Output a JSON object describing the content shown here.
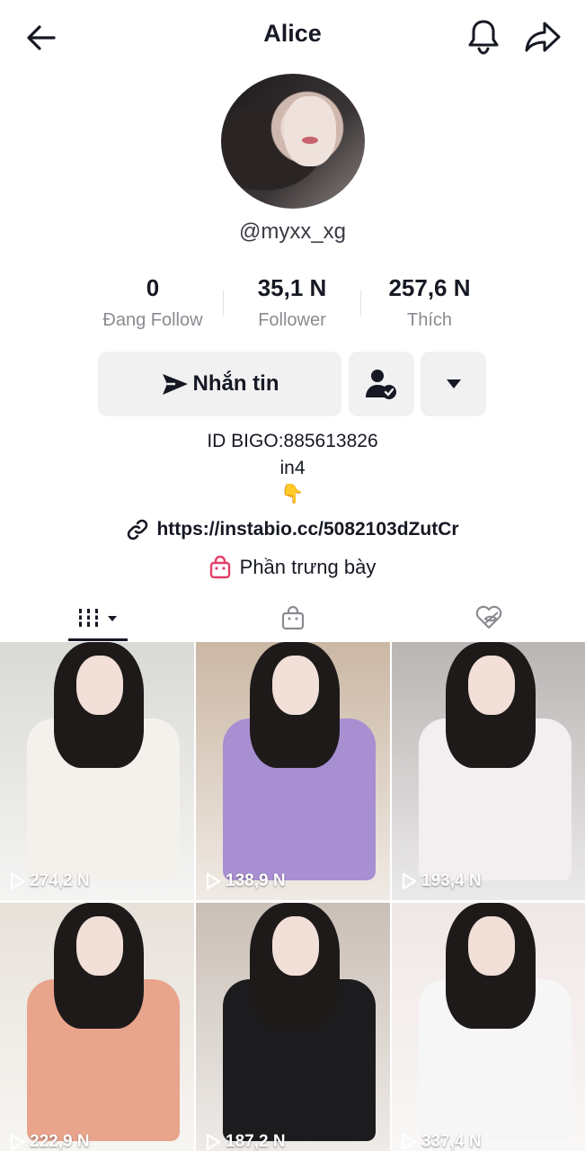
{
  "header": {
    "title": "Alice"
  },
  "profile": {
    "handle": "@myxx_xg",
    "stats": [
      {
        "value": "0",
        "label": "Đang Follow"
      },
      {
        "value": "35,1 N",
        "label": "Follower"
      },
      {
        "value": "257,6 N",
        "label": "Thích"
      }
    ],
    "actions": {
      "message_label": "Nhắn tin"
    },
    "bio": {
      "line1": "ID BIGO:885613826",
      "line2": "in4",
      "line3": "👇"
    },
    "link": "https://instabio.cc/5082103dZutCr",
    "showcase_label": "Phần trưng bày"
  },
  "videos": [
    {
      "views": "274,2 N",
      "bg": "#d9d9d6",
      "top": "#f4f1ec"
    },
    {
      "views": "138,9 N",
      "bg": "#cbb7a4",
      "top": "#a88fd1"
    },
    {
      "views": "193,4 N",
      "bg": "#b9b5b4",
      "top": "#f3eff0"
    },
    {
      "views": "222,9 N",
      "bg": "#e7e1d9",
      "top": "#e9a48c"
    },
    {
      "views": "187,2 N",
      "bg": "#c9bfb6",
      "top": "#1c1c1e"
    },
    {
      "views": "337,4 N",
      "bg": "#efe7e6",
      "top": "#f6f6f6"
    }
  ],
  "colors": {
    "accent": "#fe2c55",
    "showcase_icon": "#e33e66",
    "button_bg": "#f1f1f2",
    "muted_text": "#8a8b91"
  }
}
